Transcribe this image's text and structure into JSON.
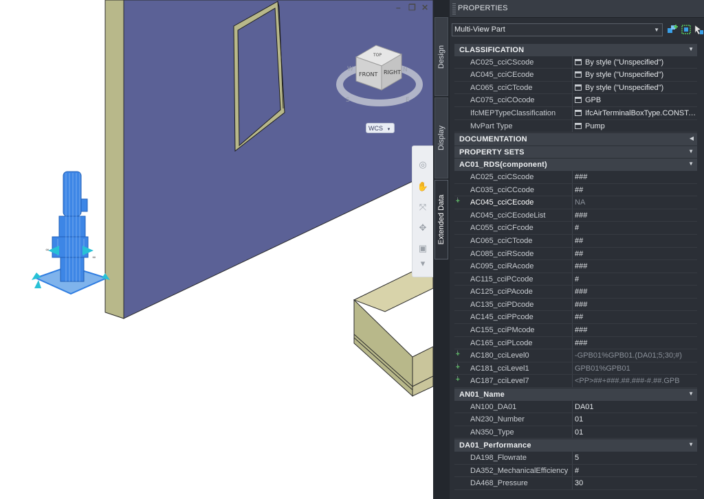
{
  "viewport": {
    "viewcube": {
      "top": "TOP",
      "front": "FRONT",
      "right": "RIGHT",
      "north": "N",
      "south": "S",
      "east": "E",
      "west": "W"
    },
    "ucs_label": "WCS",
    "window_controls": {
      "minimize": "–",
      "restore": "❐",
      "close": "✕"
    }
  },
  "palette": {
    "title": "PROPERTIES",
    "tabs": [
      {
        "label": "Design",
        "active": false
      },
      {
        "label": "Display",
        "active": false
      },
      {
        "label": "Extended Data",
        "active": true
      }
    ],
    "object_type": "Multi-View Part",
    "toolbar_icons": [
      "quick-select-icon",
      "select-objects-icon",
      "toggle-pickadd-icon"
    ],
    "categories": {
      "classification": {
        "label": "CLASSIFICATION",
        "rows": [
          {
            "key": "AC025_cciCScode",
            "value": "By style (\"Unspecified\")"
          },
          {
            "key": "AC045_cciCEcode",
            "value": "By style (\"Unspecified\")"
          },
          {
            "key": "AC065_cciCTcode",
            "value": "By style (\"Unspecified\")"
          },
          {
            "key": "AC075_cciCOcode",
            "value": "GPB"
          },
          {
            "key": "IfcMEPTypeClassification",
            "value": "IfcAirTerminalBoxType.CONSTANTFLOW"
          },
          {
            "key": "MvPart Type",
            "value": "Pump"
          }
        ]
      },
      "documentation": {
        "label": "DOCUMENTATION"
      },
      "property_sets": {
        "label": "PROPERTY SETS"
      },
      "ac01": {
        "label": "AC01_RDS(component)",
        "rows": [
          {
            "key": "AC025_cciCScode",
            "value": "###"
          },
          {
            "key": "AC035_cciCCcode",
            "value": "##"
          },
          {
            "key": "AC045_cciCEcode",
            "value": "NA"
          },
          {
            "key": "AC045_cciCEcodeList",
            "value": "###"
          },
          {
            "key": "AC055_cciCFcode",
            "value": "#"
          },
          {
            "key": "AC065_cciCTcode",
            "value": "##"
          },
          {
            "key": "AC085_cciRScode",
            "value": "##"
          },
          {
            "key": "AC095_cciRAcode",
            "value": "###"
          },
          {
            "key": "AC115_cciPCcode",
            "value": "#"
          },
          {
            "key": "AC125_cciPAcode",
            "value": "###"
          },
          {
            "key": "AC135_cciPDcode",
            "value": "###"
          },
          {
            "key": "AC145_cciPPcode",
            "value": "##"
          },
          {
            "key": "AC155_cciPMcode",
            "value": "###"
          },
          {
            "key": "AC165_cciPLcode",
            "value": "###"
          },
          {
            "key": "AC180_cciLevel0",
            "value": "-GPB01%GPB01.(DA01;5;30;#)"
          },
          {
            "key": "AC181_cciLevel1",
            "value": "GPB01%GPB01"
          },
          {
            "key": "AC187_cciLevel7",
            "value": "<PP>##+###.##.###-#.##.GPB"
          }
        ]
      },
      "an01": {
        "label": "AN01_Name",
        "rows": [
          {
            "key": "AN100_DA01",
            "value": "DA01"
          },
          {
            "key": "AN230_Number",
            "value": "01"
          },
          {
            "key": "AN350_Type",
            "value": "01"
          }
        ]
      },
      "da01": {
        "label": "DA01_Performance",
        "rows": [
          {
            "key": "DA198_Flowrate",
            "value": "5"
          },
          {
            "key": "DA352_MechanicalEfficiency",
            "value": "#"
          },
          {
            "key": "DA468_Pressure",
            "value": "30"
          }
        ]
      }
    }
  },
  "colors": {
    "wall_face": "#5b6196",
    "wall_edge": "#b8b88a",
    "pump_selected": "#2f7de1",
    "palette_bg": "#2b2f36",
    "add_indicator": "#56c35c"
  }
}
